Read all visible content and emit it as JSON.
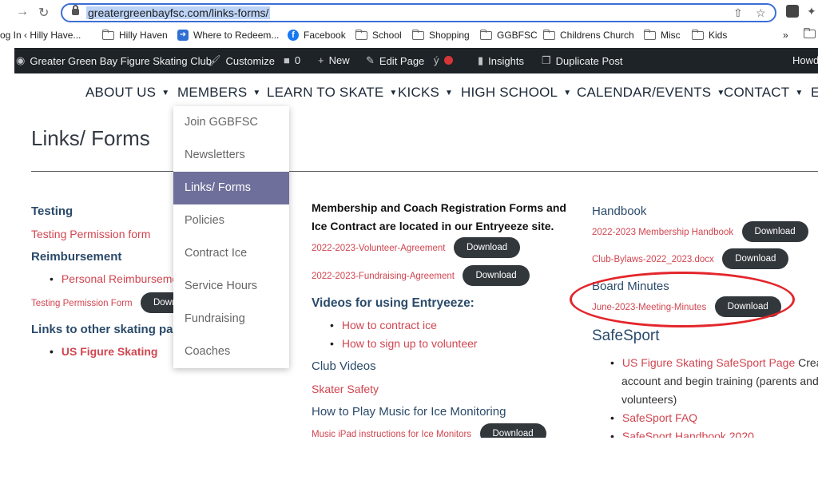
{
  "browser": {
    "url": "greatergreenbayfsc.com/links-forms/",
    "bookmarks": [
      "og In ‹ Hilly Have...",
      "Hilly Haven",
      "Where to Redeem...",
      "Facebook",
      "School",
      "Shopping",
      "GGBFSC",
      "Childrens Church",
      "Misc",
      "Kids"
    ],
    "more": "»"
  },
  "adminbar": {
    "site": "Greater Green Bay Figure Skating Club",
    "customize": "Customize",
    "comments": "0",
    "new": "New",
    "edit": "Edit Page",
    "insights": "Insights",
    "duplicate": "Duplicate Post",
    "howdy": "Howd"
  },
  "nav": [
    "ABOUT US",
    "MEMBERS",
    "LEARN TO SKATE",
    "KICKS",
    "HIGH SCHOOL",
    "CALENDAR/EVENTS",
    "CONTACT",
    "E"
  ],
  "page_title": "Links/ Forms",
  "dropdown": [
    "Join GGBFSC",
    "Newsletters",
    "Links/ Forms",
    "Policies",
    "Contract Ice",
    "Service Hours",
    "Fundraising",
    "Coaches"
  ],
  "download": "Download",
  "col1": {
    "testing": "Testing",
    "testing_link": "Testing Permission form",
    "reimbursement": "Reimbursement",
    "personal": "Personal Reimburseme",
    "testing_form": "Testing Permission Form",
    "download_partial": "Downlo",
    "links_other": "Links to other skating pag",
    "usfs": "US Figure Skating"
  },
  "col2": {
    "membership_line1": "Membership and Coach Registration Forms and",
    "membership_line2": "Ice Contract are located in our Entryeeze site.",
    "volunteer": "2022-2023-Volunteer-Agreement",
    "fundraising": "2022-2023-Fundraising-Agreement",
    "videos_heading": "Videos for using Entryeeze:",
    "video1": "How to contract ice",
    "video2": "How to sign up to volunteer",
    "club_videos": "Club Videos",
    "skater_safety": "Skater Safety",
    "music_heading": "How to Play Music for Ice Monitoring",
    "music_link": "Music iPad instructions for Ice Monitors"
  },
  "col3": {
    "handbook": "Handbook",
    "membership_handbook": "2022-2023 Membership Handbook",
    "bylaws": "Club-Bylaws-2022_2023.docx",
    "board_minutes": "Board Minutes",
    "minutes_link": "June-2023-Meeting-Minutes",
    "safesport": "SafeSport",
    "ss_page": "US Figure Skating SafeSport Page",
    "ss_page_rest": " Creat",
    "ss_line2": "account and begin training (parents and",
    "ss_line3": "volunteers)",
    "ss_faq": "SafeSport FAQ",
    "ss_handbook": "SafeSport Handbook 2020"
  },
  "colors": {
    "annotation": "#e3262b",
    "active_menu": "#6e6f9a",
    "link": "#d14550",
    "heading": "#2a4a6a"
  }
}
